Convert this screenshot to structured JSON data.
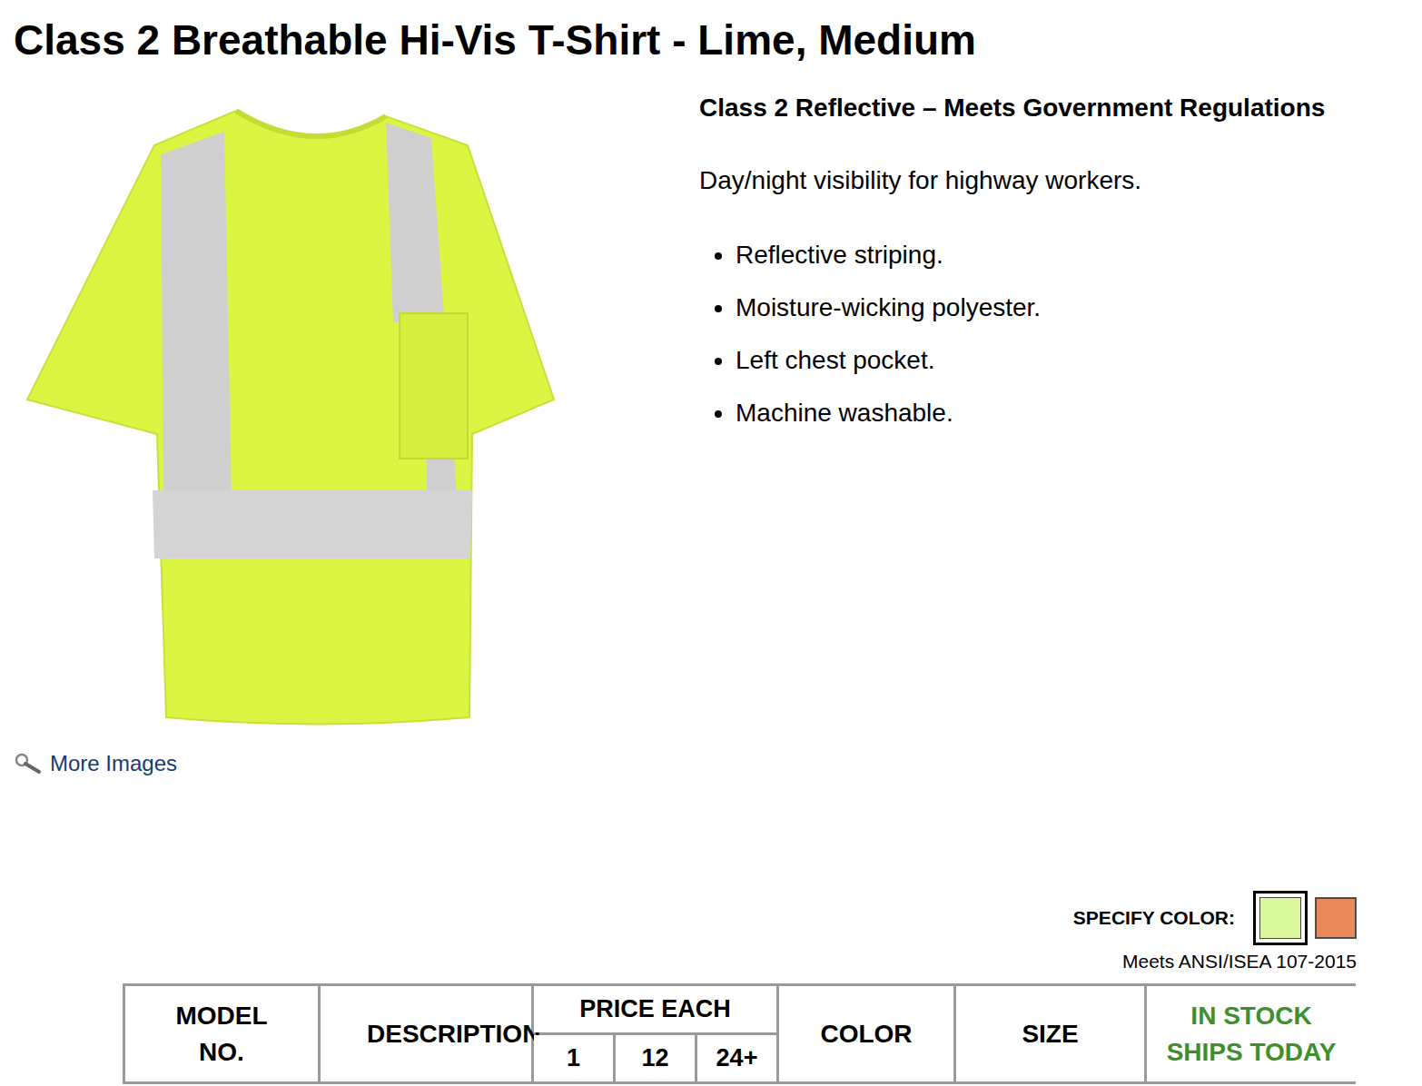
{
  "product": {
    "title": "Class 2 Breathable Hi-Vis T-Shirt - Lime, Medium"
  },
  "gallery": {
    "link": "More Images"
  },
  "details": {
    "subtitle": "Class 2 Reflective – Meets Government Regulations",
    "description": "Day/night visibility for highway workers.",
    "bullets": [
      "Reflective striping.",
      "Moisture-wicking polyester.",
      "Left chest pocket.",
      "Machine washable."
    ]
  },
  "color_picker": {
    "label": "SPECIFY COLOR:",
    "options": [
      {
        "name": "Lime",
        "selected": true,
        "color": "#dbf99c"
      },
      {
        "name": "Orange",
        "selected": false,
        "color": "#e8895a"
      }
    ]
  },
  "standard": "Meets ANSI/ISEA 107-2015",
  "table": {
    "columns": [
      {
        "label": "MODEL NO.",
        "kind": "plain"
      },
      {
        "label": "DESCRIPTION",
        "kind": "plain"
      },
      {
        "label": "PRICE EACH",
        "kind": "group",
        "sub": [
          "1",
          "12",
          "24+"
        ]
      },
      {
        "label": "COLOR",
        "kind": "plain"
      },
      {
        "label": "SIZE",
        "kind": "plain"
      },
      {
        "label": "IN STOCK SHIPS TODAY",
        "kind": "stock"
      }
    ]
  }
}
